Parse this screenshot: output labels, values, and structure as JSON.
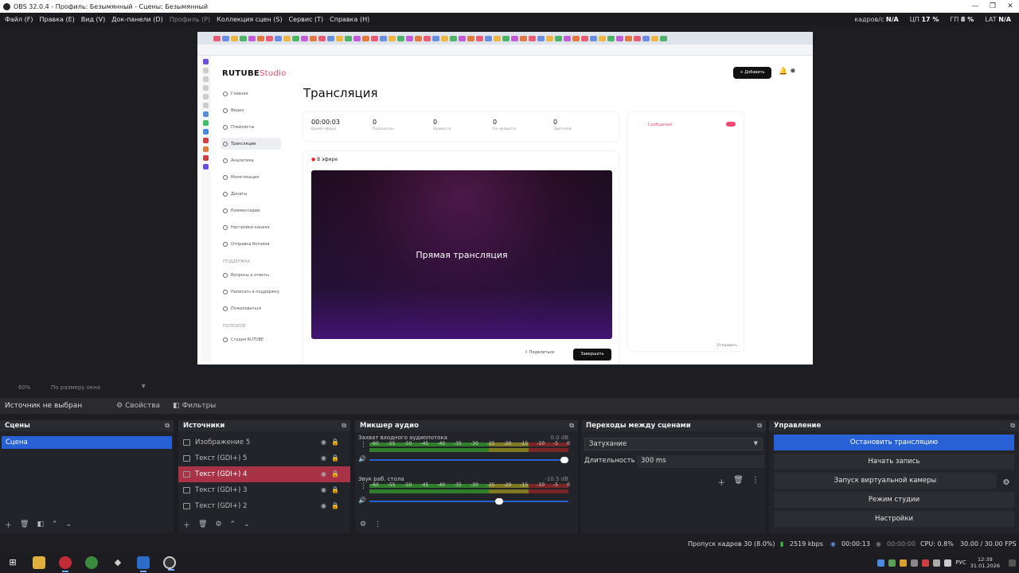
{
  "window": {
    "title": "OBS 32.0.4 - Профиль: Безымянный - Сцены: Безымянный"
  },
  "menu": [
    {
      "label": "Файл (F)",
      "enabled": true
    },
    {
      "label": "Правка (E)",
      "enabled": true
    },
    {
      "label": "Вид (V)",
      "enabled": true
    },
    {
      "label": "Док-панели (D)",
      "enabled": true
    },
    {
      "label": "Профиль (P)",
      "enabled": false
    },
    {
      "label": "Коллекция сцен (S)",
      "enabled": true
    },
    {
      "label": "Сервис (T)",
      "enabled": true
    },
    {
      "label": "Справка (H)",
      "enabled": true
    }
  ],
  "topstats": {
    "frames_label": "кадров/с",
    "frames_value": "N/A",
    "cpu_label": "ЦП",
    "cpu_value": "17 %",
    "gpu_label": "ГП",
    "gpu_value": "8 %",
    "lat_label": "LAT",
    "lat_value": "N/A"
  },
  "preview": {
    "brand": "RUTUBE",
    "brand_suffix": "Studio",
    "heading": "Трансляция",
    "add_button": "+ Добавить",
    "stats": [
      {
        "value": "00:00:03",
        "label": "Время эфира"
      },
      {
        "value": "0",
        "label": "Просмотры"
      },
      {
        "value": "0",
        "label": "Нравится"
      },
      {
        "value": "0",
        "label": "Не нравится"
      },
      {
        "value": "0",
        "label": "Зрителей"
      }
    ],
    "live_label": "В эфире",
    "video_text": "Прямая трансляция",
    "share": "Поделиться",
    "finish": "Завершить",
    "chat_title": "Сообщения",
    "chat_send": "Отправить",
    "nav": [
      "Главная",
      "Видео",
      "Плейлисты",
      "Трансляции",
      "Аналитика",
      "Монетизация",
      "Донаты",
      "Комментарии",
      "Настройки канала",
      "Отправка боталов"
    ],
    "nav_section": "ПОДДЕРЖКА",
    "nav_support": [
      "Вопросы и ответы",
      "Написать в поддержку",
      "Пожаловаться"
    ],
    "nav_section2": "ПОЛЕЗНОЕ",
    "nav_extra": [
      "Студия RUTUBE"
    ]
  },
  "zoom": {
    "level": "60%",
    "mode": "По размеру окна"
  },
  "source_toolbar": {
    "none_selected": "Источник не выбран",
    "properties": "Свойства",
    "filters": "Фильтры"
  },
  "docks": {
    "scenes": {
      "title": "Сцены",
      "items": [
        "Сцена"
      ]
    },
    "sources": {
      "title": "Источники",
      "items": [
        {
          "name": "Изображение 5",
          "selected": false
        },
        {
          "name": "Текст (GDI+) 5",
          "selected": false
        },
        {
          "name": "Текст (GDI+) 4",
          "selected": true
        },
        {
          "name": "Текст (GDI+) 3",
          "selected": false
        },
        {
          "name": "Текст (GDI+) 2",
          "selected": false
        }
      ]
    },
    "mixer": {
      "title": "Микшер аудио",
      "scale": [
        "-60",
        "-55",
        "-50",
        "-45",
        "-40",
        "-35",
        "-30",
        "-25",
        "-20",
        "-15",
        "-10",
        "-5",
        "0"
      ],
      "channels": [
        {
          "name": "Захват входного аудиопотока",
          "db": "0.0 dB",
          "volume": 1.0
        },
        {
          "name": "Звук раб. стола",
          "db": "-10.5 dB",
          "volume": 0.66
        }
      ]
    },
    "transitions": {
      "title": "Переходы между сценами",
      "selected": "Затухание",
      "duration_label": "Длительность",
      "duration_value": "300 ms"
    },
    "controls": {
      "title": "Управление",
      "buttons": [
        "Остановить трансляцию",
        "Начать запись",
        "Запуск виртуальной камеры",
        "Режим студии",
        "Настройки"
      ]
    }
  },
  "status": {
    "dropped": "Пропуск кадров 30 (8.0%)",
    "bitrate": "2519 kbps",
    "stream_time": "00:00:13",
    "rec_time": "00:00:00",
    "cpu": "CPU: 0.8%",
    "fps": "30.00 / 30.00 FPS"
  },
  "taskbar": {
    "lang": "РУС",
    "time": "12:39",
    "date": "31.01.2026"
  },
  "colors": {
    "accent": "#2861d6",
    "selected_source": "#a83347",
    "rutube_pink": "#f04870"
  }
}
